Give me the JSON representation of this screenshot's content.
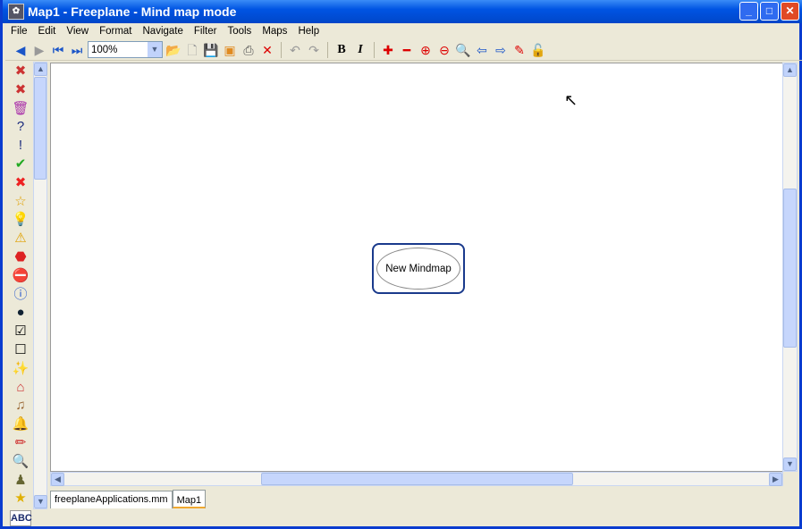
{
  "window": {
    "title": "Map1 - Freeplane - Mind map mode"
  },
  "menu": [
    "File",
    "Edit",
    "View",
    "Format",
    "Navigate",
    "Filter",
    "Tools",
    "Maps",
    "Help"
  ],
  "toolbar": {
    "zoom_value": "100%",
    "bold": "B",
    "italic": "I"
  },
  "map": {
    "root_node": "New Mindmap"
  },
  "tabs": [
    {
      "label": "freeplaneApplications.mm",
      "active": false
    },
    {
      "label": "Map1",
      "active": true
    }
  ],
  "status": {
    "spellcheck": "ABC"
  },
  "side_icons": [
    "remove-first-icon",
    "remove-last-icon",
    "remove-all-icon",
    "help-icon",
    "important-icon",
    "ok-icon",
    "cancel-icon",
    "star-icon",
    "idea-icon",
    "warning-icon",
    "stop-icon",
    "stop-sign-icon",
    "info-icon",
    "bomb-icon",
    "checked-icon",
    "unchecked-icon",
    "wizard-icon",
    "home-icon",
    "music-icon",
    "bell-icon",
    "pencil-icon",
    "magnifier-icon",
    "stamp-icon",
    "star2-icon"
  ]
}
